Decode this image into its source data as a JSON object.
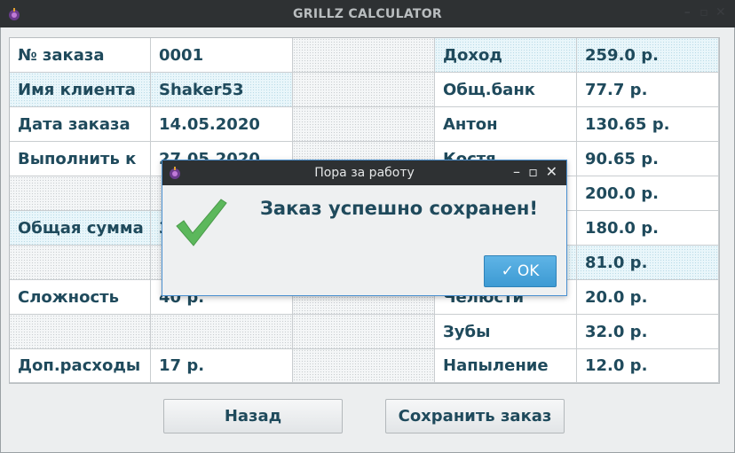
{
  "window": {
    "title": "GRILLZ CALCULATOR"
  },
  "left_table": [
    {
      "label": "№ заказа",
      "value": "0001",
      "highlight": false
    },
    {
      "label": "Имя клиента",
      "value": "Shaker53",
      "highlight": true
    },
    {
      "label": "Дата заказа",
      "value": "14.05.2020",
      "highlight": false
    },
    {
      "label": "Выполнить к",
      "value": "27.05.2020",
      "highlight": false
    },
    {
      "label": "",
      "value": "",
      "highlight": false,
      "empty": true
    },
    {
      "label": "Общая сумма",
      "value": "3",
      "highlight": true
    },
    {
      "label": "",
      "value": "",
      "highlight": false,
      "empty": true
    },
    {
      "label": "Сложность",
      "value": "40 р.",
      "highlight": false
    },
    {
      "label": "",
      "value": "",
      "highlight": false,
      "empty": true
    },
    {
      "label": "Доп.расходы",
      "value": "17 р.",
      "highlight": false
    }
  ],
  "right_table": [
    {
      "label": "Доход",
      "value": "259.0 р.",
      "highlight": true
    },
    {
      "label": "Общ.банк",
      "value": "77.7 р.",
      "highlight": false
    },
    {
      "label": "Антон",
      "value": "130.65 р.",
      "highlight": false
    },
    {
      "label": "Костя",
      "value": "90.65 р.",
      "highlight": false
    },
    {
      "label": "",
      "value": "200.0 р.",
      "highlight": false
    },
    {
      "label": "",
      "value": "180.0 р.",
      "highlight": false
    },
    {
      "label": "",
      "value": "81.0 р.",
      "highlight": true
    },
    {
      "label": "Челюсти",
      "value": "20.0 р.",
      "highlight": false
    },
    {
      "label": "Зубы",
      "value": "32.0 р.",
      "highlight": false
    },
    {
      "label": "Напыление",
      "value": "12.0 р.",
      "highlight": false
    }
  ],
  "buttons": {
    "back": "Назад",
    "save": "Сохранить заказ"
  },
  "dialog": {
    "title": "Пора за работу",
    "message": "Заказ успешно сохранен!",
    "ok_label": "OK",
    "ok_icon": "check-icon",
    "icon": "success-check-icon"
  },
  "colors": {
    "text": "#1f4a5c",
    "accent": "#3d9ad3",
    "check": "#5cb85c"
  }
}
